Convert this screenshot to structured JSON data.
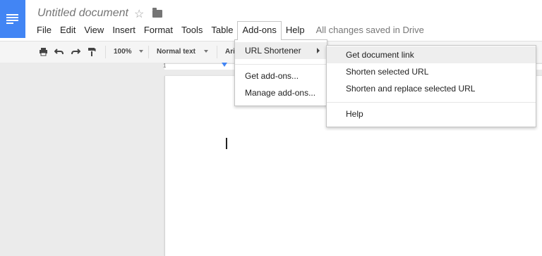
{
  "document": {
    "title": "Untitled document"
  },
  "menubar": {
    "items": [
      "File",
      "Edit",
      "View",
      "Insert",
      "Format",
      "Tools",
      "Table",
      "Add-ons",
      "Help"
    ],
    "status": "All changes saved in Drive"
  },
  "toolbar": {
    "zoom": "100%",
    "style": "Normal text",
    "font": "Ari",
    "icons": [
      "print-icon",
      "undo-icon",
      "redo-icon",
      "paint-format-icon"
    ]
  },
  "ruler": {
    "start_label": "1"
  },
  "addons_menu": {
    "items": [
      "URL Shortener",
      "Get add-ons...",
      "Manage add-ons..."
    ]
  },
  "url_shortener_menu": {
    "items": [
      "Get document link",
      "Shorten selected URL",
      "Shorten and replace selected URL",
      "Help"
    ]
  },
  "colors": {
    "accent": "#4285f4"
  }
}
